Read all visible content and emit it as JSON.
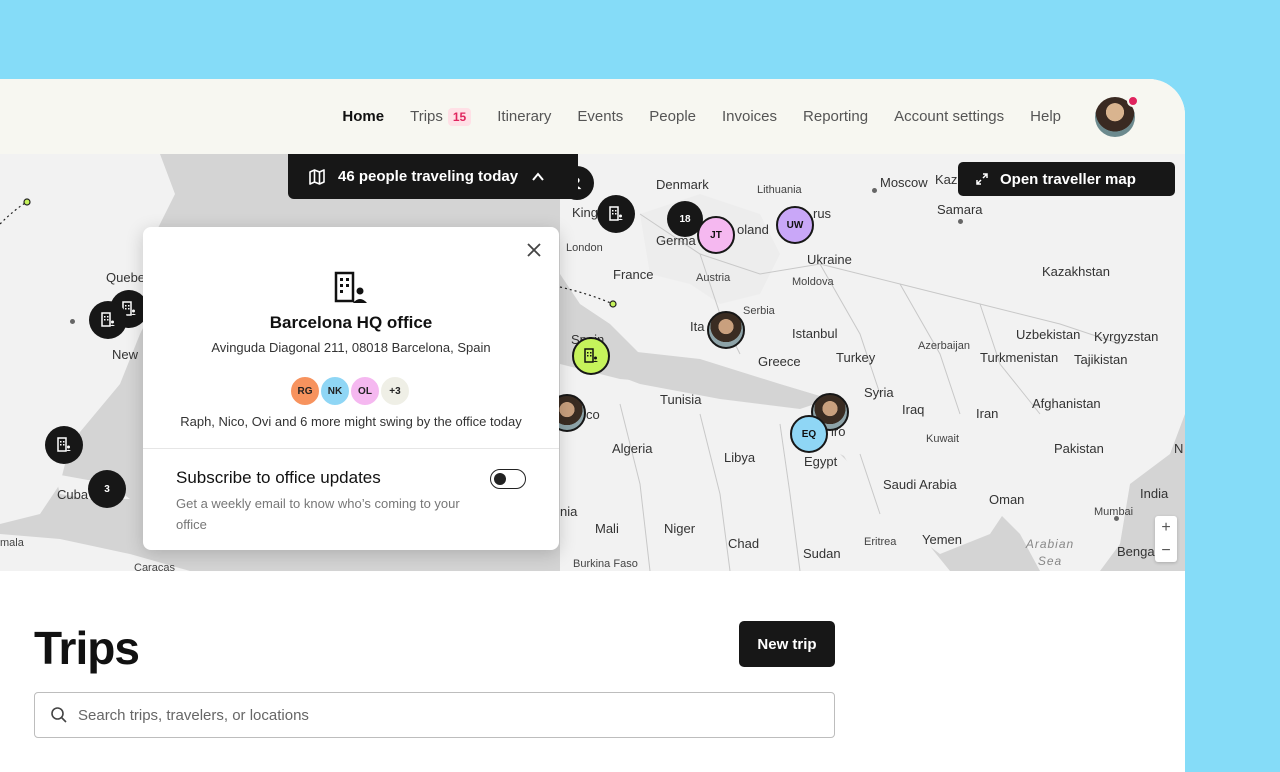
{
  "nav": {
    "items": [
      {
        "label": "Home",
        "active": true
      },
      {
        "label": "Trips",
        "badge": "15"
      },
      {
        "label": "Itinerary"
      },
      {
        "label": "Events"
      },
      {
        "label": "People"
      },
      {
        "label": "Invoices"
      },
      {
        "label": "Reporting"
      },
      {
        "label": "Account settings"
      },
      {
        "label": "Help"
      }
    ],
    "avatar_icon": "user-avatar",
    "notification_color": "#E0245E"
  },
  "map": {
    "travel_pill": {
      "icon": "map-icon",
      "label": "46 people traveling today",
      "chevron": "chevron-up-icon"
    },
    "open_map": {
      "icon": "expand-icon",
      "label": "Open traveller map"
    },
    "labels": {
      "denmark": "Denmark",
      "lithuania": "Lithuania",
      "moscow": "Moscow",
      "kaz_short": "Kaz",
      "samara": "Samara",
      "belarus_frag": "rus",
      "poland_frag": "oland",
      "germany": "Germa",
      "kingdom_frag": "King",
      "london": "London",
      "france": "France",
      "austria": "Austria",
      "ukraine": "Ukraine",
      "moldova": "Moldova",
      "kazakhstan": "Kazakhstan",
      "serbia": "Serbia",
      "italy_frag": "Ita",
      "istanbul": "Istanbul",
      "azerbaijan": "Azerbaijan",
      "uzbekistan": "Uzbekistan",
      "kyrgyzstan": "Kyrgyzstan",
      "greece": "Greece",
      "turkey": "Turkey",
      "turkmenistan": "Turkmenistan",
      "tajikistan": "Tajikistan",
      "spain": "Spain",
      "tunisia": "Tunisia",
      "syria": "Syria",
      "iraq": "Iraq",
      "iran": "Iran",
      "afghanistan": "Afghanistan",
      "kuwait": "Kuwait",
      "algeria": "Algeria",
      "libya": "Libya",
      "egypt": "Egypt",
      "cairo_frag": "iro",
      "pakistan": "Pakistan",
      "saudi": "Saudi Arabia",
      "oman": "Oman",
      "india": "India",
      "mumbai": "Mumbai",
      "mali": "Mali",
      "niger": "Niger",
      "chad": "Chad",
      "sudan": "Sudan",
      "eritrea": "Eritrea",
      "yemen": "Yemen",
      "bengal_frag": "Benga",
      "arabian_sea": "Arabian Sea",
      "burkina": "Burkina Faso",
      "caracas": "Caracas",
      "quebec": "Quebe",
      "new_frag": "New",
      "cuba": "Cuba",
      "guatemala_frag": "mala",
      "mauritania_frag": "nia",
      "morocco_frag": "co",
      "n_frag": "N"
    },
    "pins": {
      "cluster_18": "18",
      "cluster_3": "3",
      "jt": "JT",
      "uw": "UW",
      "eq": "EQ"
    },
    "zoom_in": "+",
    "zoom_out": "−"
  },
  "office_popup": {
    "name": "Barcelona HQ office",
    "address": "Avinguda Diagonal 211, 08018 Barcelona, Spain",
    "avatars": [
      {
        "initials": "RG",
        "color": "#F7935E"
      },
      {
        "initials": "NK",
        "color": "#8FD6F5"
      },
      {
        "initials": "OL",
        "color": "#F5B8F0"
      },
      {
        "initials": "+3",
        "color": "#EFEFE6"
      }
    ],
    "note": "Raph, Nico, Ovi and 6 more might swing by the office today",
    "subscribe_title": "Subscribe to office updates",
    "subscribe_desc": "Get a weekly email to know who’s coming to your office",
    "toggle_on": false
  },
  "trips": {
    "title": "Trips",
    "new_trip_label": "New trip",
    "search_placeholder": "Search trips, travelers, or locations"
  }
}
